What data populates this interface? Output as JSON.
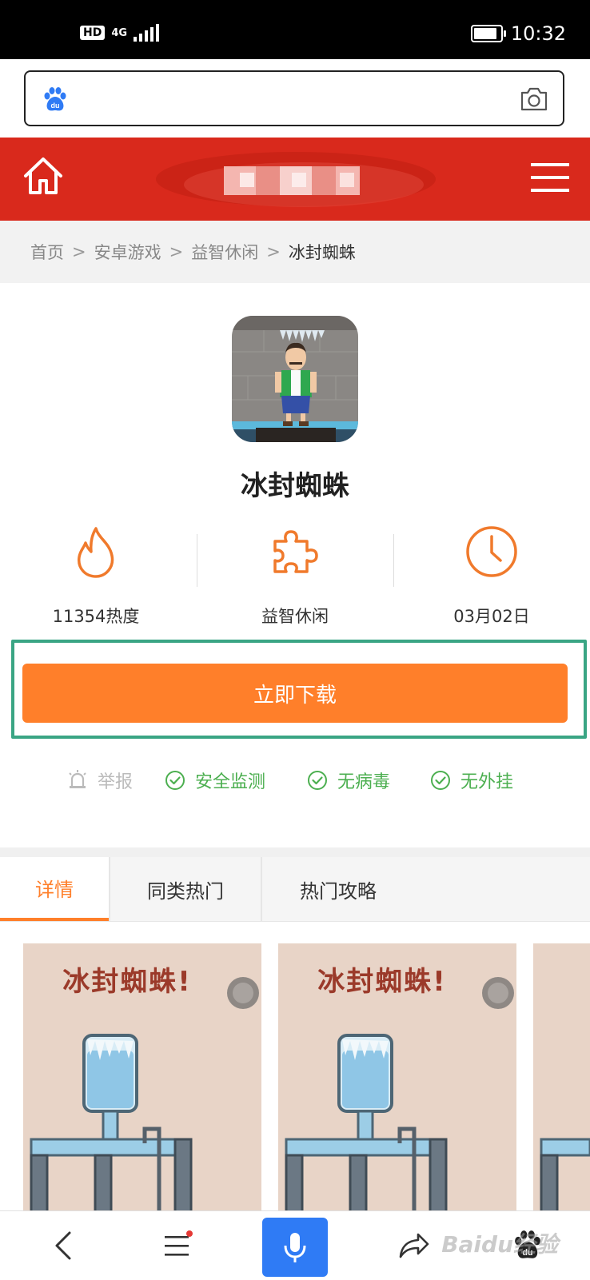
{
  "status_bar": {
    "hd": "HD",
    "network": "4G",
    "time": "10:32",
    "battery_level": 0.85
  },
  "search": {
    "value": "",
    "placeholder": ""
  },
  "breadcrumb": {
    "items": [
      "首页",
      "安卓游戏",
      "益智休闲"
    ],
    "separator": ">",
    "current": "冰封蜘蛛"
  },
  "app": {
    "title": "冰封蜘蛛",
    "stats": {
      "heat": "11354热度",
      "category": "益智休闲",
      "date": "03月02日"
    },
    "download_label": "立即下载",
    "badges": {
      "report": "举报",
      "safe": "安全监测",
      "virus": "无病毒",
      "plugin": "无外挂"
    }
  },
  "tabs": [
    {
      "label": "详情",
      "active": true
    },
    {
      "label": "同类热门",
      "active": false
    },
    {
      "label": "热门攻略",
      "active": false
    }
  ],
  "screenshots": [
    {
      "title": "冰封蜘蛛!"
    },
    {
      "title": "冰封蜘蛛!"
    }
  ],
  "watermark": "Baidu经验",
  "colors": {
    "header_red": "#d9291c",
    "accent_orange": "#ff7f2a",
    "success_green": "#4caf50",
    "highlight_frame": "#3aa584",
    "mic_blue": "#2f7bf5"
  }
}
